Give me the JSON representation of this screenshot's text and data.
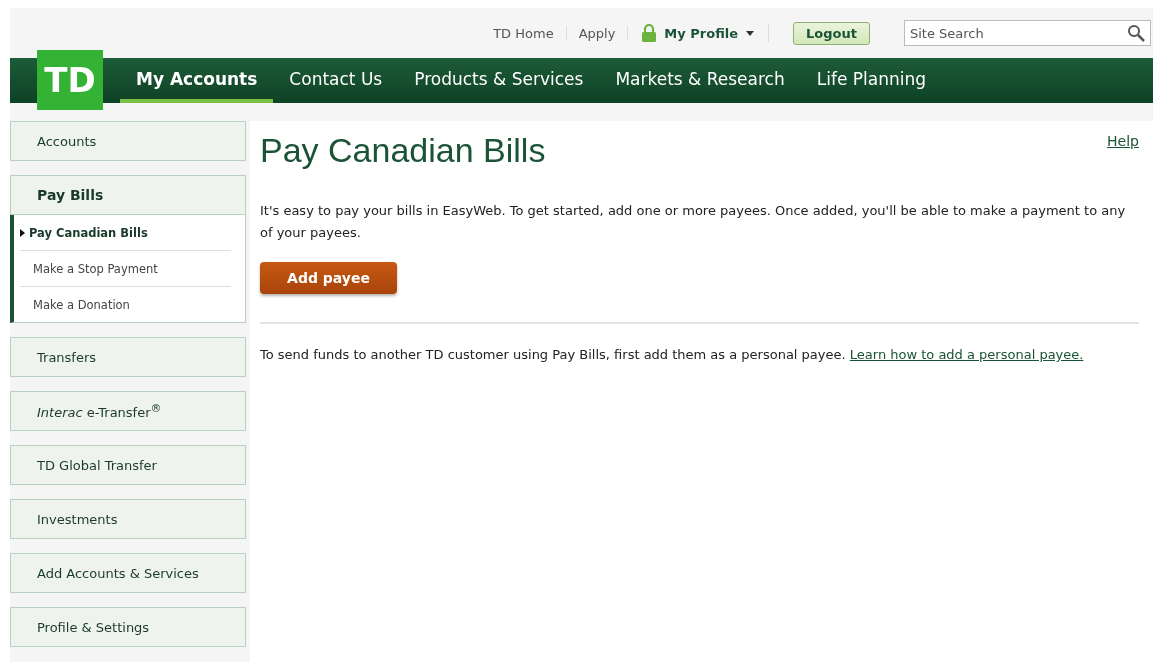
{
  "top_links": [
    {
      "label": "TD Home"
    },
    {
      "label": "Apply"
    }
  ],
  "profile": {
    "label": "My Profile",
    "locked": true
  },
  "logout": {
    "label": "Logout"
  },
  "search": {
    "placeholder": "Site Search"
  },
  "logo": {
    "text": "TD"
  },
  "nav": [
    {
      "label": "My Accounts",
      "selected": true
    },
    {
      "label": "Contact Us",
      "selected": false
    },
    {
      "label": "Products & Services",
      "selected": false
    },
    {
      "label": "Markets & Research",
      "selected": false
    },
    {
      "label": "Life Planning",
      "selected": false
    }
  ],
  "sidebar": [
    {
      "label": "Accounts",
      "expanded": false
    },
    {
      "label": "Pay Bills",
      "expanded": true,
      "children": [
        {
          "label": "Pay Canadian Bills",
          "selected": true
        },
        {
          "label": "Make a Stop Payment",
          "selected": false
        },
        {
          "label": "Make a Donation",
          "selected": false
        }
      ]
    },
    {
      "label": "Transfers",
      "expanded": false
    },
    {
      "label": "*Interac* e-Transfer$^{®}$",
      "expanded": false
    },
    {
      "label": "TD Global Transfer",
      "expanded": false
    },
    {
      "label": "Investments",
      "expanded": false
    },
    {
      "label": "Add Accounts & Services",
      "expanded": false
    },
    {
      "label": "Profile & Settings",
      "expanded": false
    }
  ],
  "main": {
    "title": "Pay Canadian Bills",
    "help": "Help",
    "intro": "It's easy to pay your bills in EasyWeb. To get started, add one or more payees. Once added, you'll be able to make a payment to any of your payees.",
    "button": "Add payee",
    "note": "To send funds to another TD customer using Pay Bills, first add them as a personal payee.",
    "note_link": "Learn how to add a personal payee."
  }
}
